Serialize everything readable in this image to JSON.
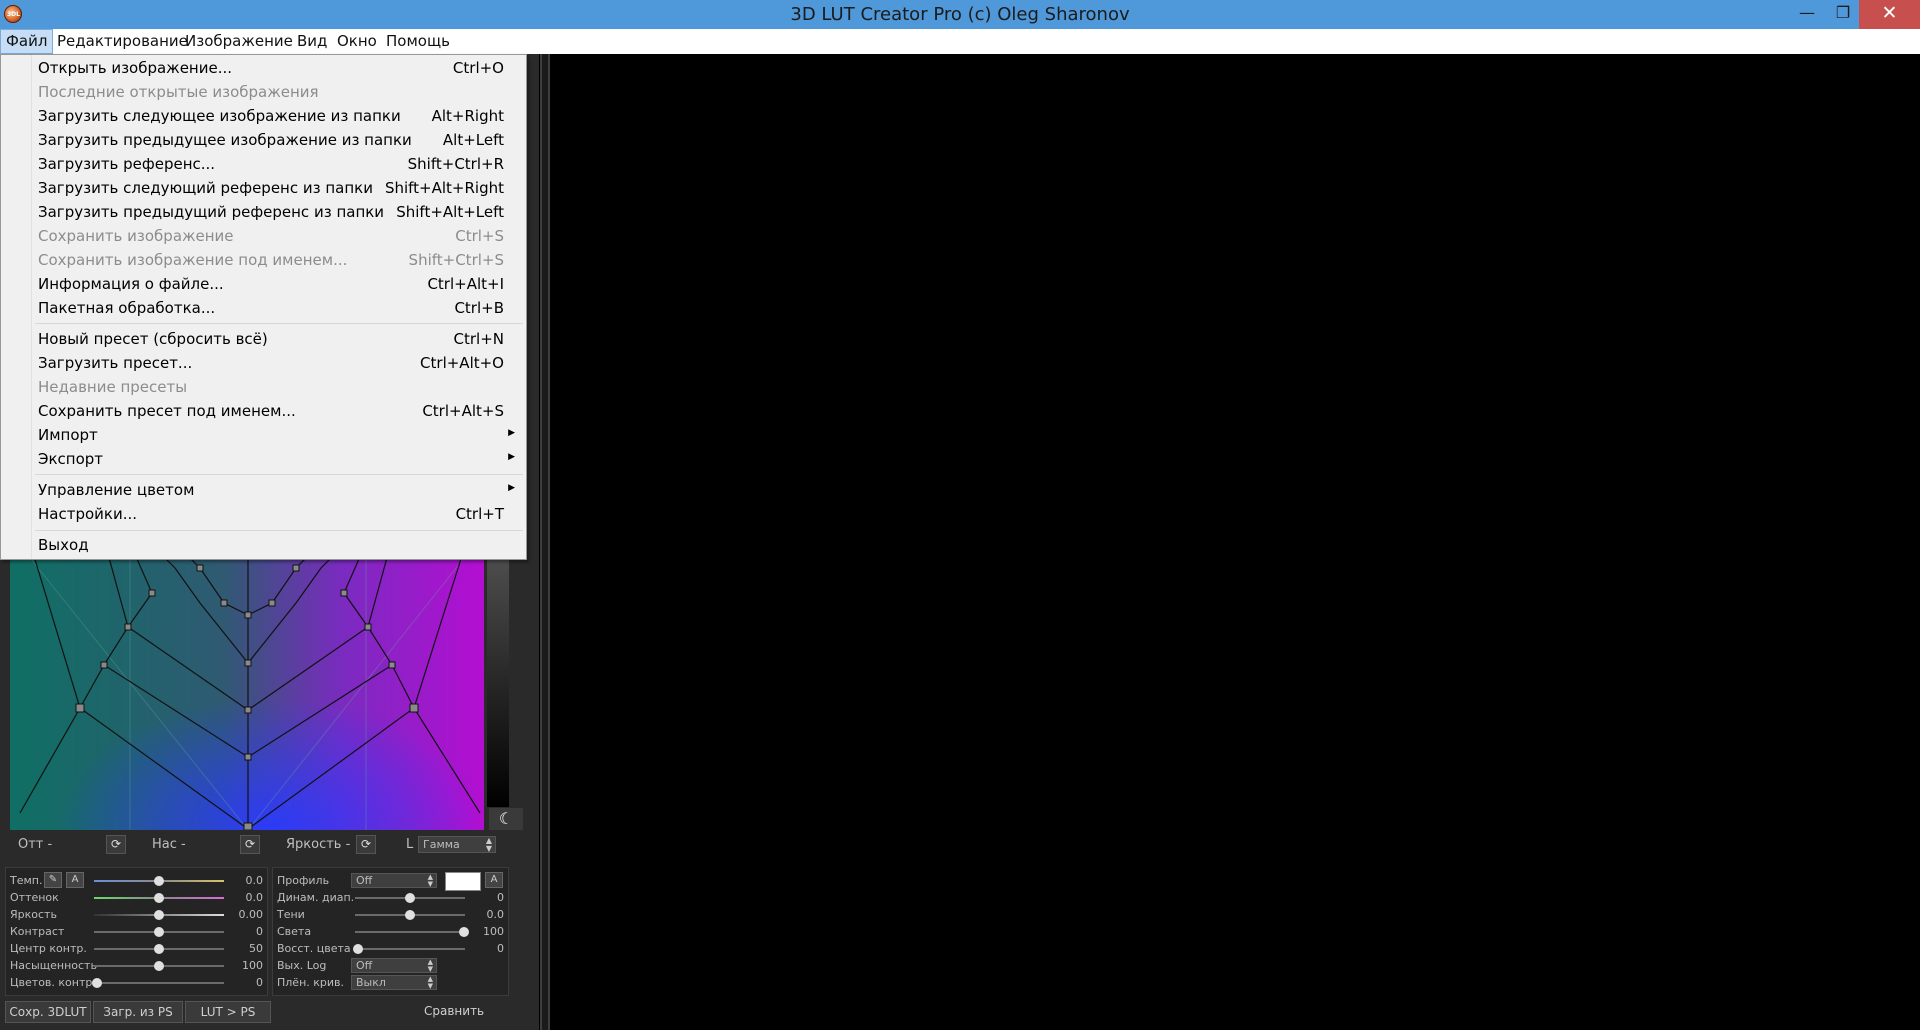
{
  "window": {
    "title": "3D LUT Creator Pro (c) Oleg Sharonov",
    "app_icon_text": "3DL",
    "minimize_glyph": "—",
    "maximize_glyph": "❐",
    "close_glyph": "✕"
  },
  "menubar": {
    "items": [
      "Файл",
      "Редактирование",
      "Изображение",
      "Вид",
      "Окно",
      "Помощь"
    ]
  },
  "file_menu": {
    "items": [
      {
        "label": "Открыть изображение...",
        "shortcut": "Ctrl+O",
        "enabled": true
      },
      {
        "label": "Последние открытые изображения",
        "shortcut": "",
        "enabled": false
      },
      {
        "label": "Загрузить следующее изображение из папки",
        "shortcut": "Alt+Right",
        "enabled": true
      },
      {
        "label": "Загрузить предыдущее изображение из папки",
        "shortcut": "Alt+Left",
        "enabled": true
      },
      {
        "label": "Загрузить референс...",
        "shortcut": "Shift+Ctrl+R",
        "enabled": true
      },
      {
        "label": "Загрузить следующий референс из папки",
        "shortcut": "Shift+Alt+Right",
        "enabled": true
      },
      {
        "label": "Загрузить предыдущий референс из папки",
        "shortcut": "Shift+Alt+Left",
        "enabled": true
      },
      {
        "label": "Сохранить изображение",
        "shortcut": "Ctrl+S",
        "enabled": false
      },
      {
        "label": "Сохранить изображение под именем...",
        "shortcut": "Shift+Ctrl+S",
        "enabled": false
      },
      {
        "label": "Информация о файле...",
        "shortcut": "Ctrl+Alt+I",
        "enabled": true
      },
      {
        "label": "Пакетная обработка...",
        "shortcut": "Ctrl+B",
        "enabled": true
      },
      {
        "label": "Новый пресет (сбросить всё)",
        "shortcut": "Ctrl+N",
        "enabled": true
      },
      {
        "label": "Загрузить пресет...",
        "shortcut": "Ctrl+Alt+O",
        "enabled": true
      },
      {
        "label": "Недавние пресеты",
        "shortcut": "",
        "enabled": false
      },
      {
        "label": "Сохранить пресет под именем...",
        "shortcut": "Ctrl+Alt+S",
        "enabled": true
      },
      {
        "label": "Импорт",
        "shortcut": "",
        "enabled": true,
        "submenu": true
      },
      {
        "label": "Экспорт",
        "shortcut": "",
        "enabled": true,
        "submenu": true
      },
      {
        "label": "Управление цветом",
        "shortcut": "",
        "enabled": true,
        "submenu": true
      },
      {
        "label": "Настройки...",
        "shortcut": "Ctrl+T",
        "enabled": true
      },
      {
        "label": "Выход",
        "shortcut": "",
        "enabled": true
      }
    ],
    "submenu_glyph": "▶"
  },
  "axis_row": {
    "hue_label": "Отт -",
    "sat_label": "Нас -",
    "bright_label": "Яркость -",
    "l_label": "L",
    "gamma_value": "Гамма",
    "reset_glyph": "⟳",
    "arrows_glyph": "▲▼"
  },
  "moon_glyph": "☾",
  "left_sliders": [
    {
      "name": "Темп.",
      "value": "0.0",
      "pos": 0.5
    },
    {
      "name": "Оттенок",
      "value": "0.0",
      "pos": 0.5
    },
    {
      "name": "Яркость",
      "value": "0.00",
      "pos": 0.5
    },
    {
      "name": "Контраст",
      "value": "0",
      "pos": 0.5
    },
    {
      "name": "Центр контр.",
      "value": "50",
      "pos": 0.5
    },
    {
      "name": "Насыщенность",
      "value": "100",
      "pos": 0.5
    },
    {
      "name": "Цветов. контр.",
      "value": "0",
      "pos": 0.0
    }
  ],
  "temp_buttons": {
    "eyedropper_glyph": "✎",
    "auto_label": "A"
  },
  "right_panel": {
    "profile_label": "Профиль",
    "profile_value": "Off",
    "auto_label": "A",
    "sliders": [
      {
        "name": "Динам. диап.",
        "value": "0",
        "pos": 0.5
      },
      {
        "name": "Тени",
        "value": "0.0",
        "pos": 0.5
      },
      {
        "name": "Света",
        "value": "100",
        "pos": 1.0
      },
      {
        "name": "Восст. цвета",
        "value": "0",
        "pos": 0.0
      }
    ],
    "log_label": "Вых. Log",
    "log_value": "Off",
    "film_label": "Плён. крив.",
    "film_value": "Выкл"
  },
  "bottom_bar": {
    "save_3dlut": "Сохр. 3DLUT",
    "load_ps": "Загр. из PS",
    "lut_ps": "LUT > PS",
    "compare": "Сравнить"
  }
}
